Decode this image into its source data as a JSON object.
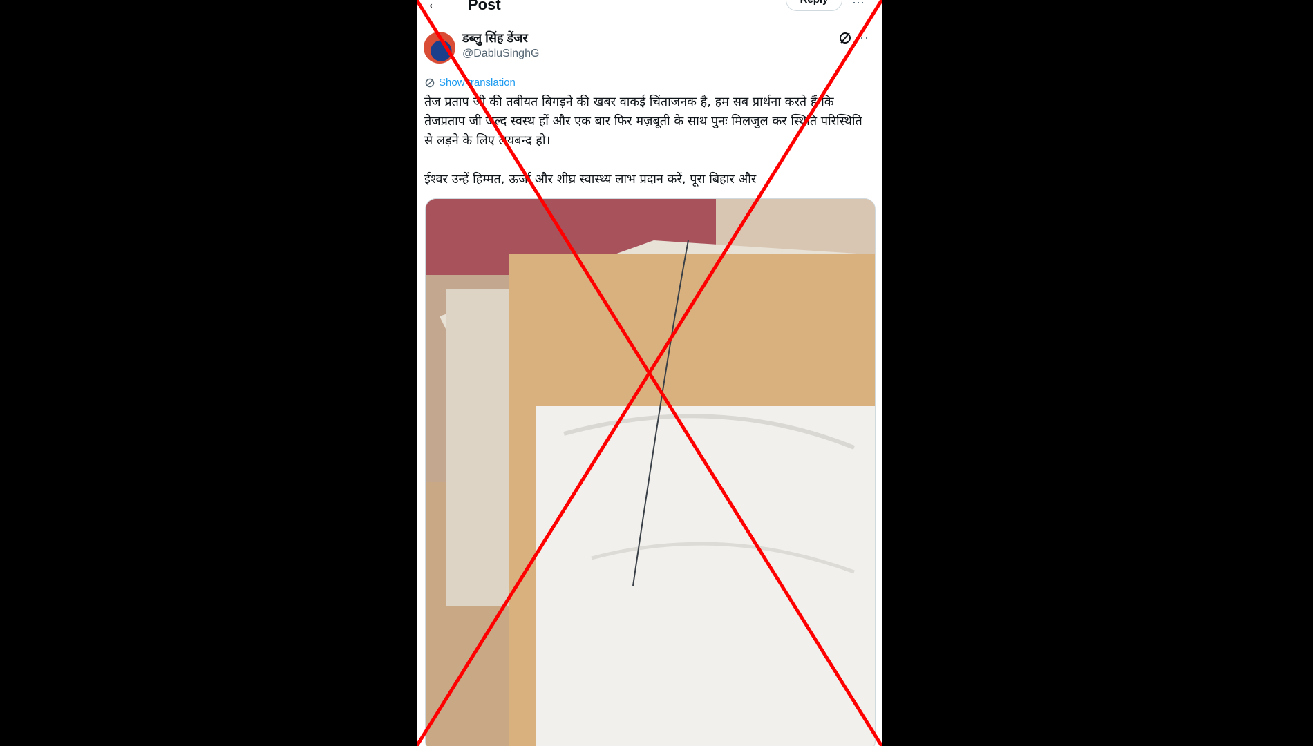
{
  "header": {
    "back_icon": "arrow-left-icon",
    "title": "Post",
    "reply_label": "Reply",
    "more_label": "⋯"
  },
  "post": {
    "display_name": "डब्लु सिंह डेंजर",
    "handle": "@DabluSinghG",
    "more_label": "···",
    "translate_label": "Show translation",
    "text_paragraph_1": "तेज प्रताप जी की तबीयत बिगड़ने की खबर वाकई चिंताजनक है, हम सब प्रार्थना करते हैं कि तेजप्रताप जी जल्द स्वस्थ हों और एक बार फिर मज़बूती के साथ पुनः मिलजुल कर स्थिति परिस्थिति से लड़ने के लिए लयबन्द हो।",
    "text_paragraph_2": "ईश्वर उन्हें हिम्मत, ऊर्जा और शीघ्र स्वास्थ्य लाभ प्रदान करें, पूरा बिहार और",
    "media_icon": "photo-placeholder"
  },
  "overlay": {
    "icon": "red-x-cross-mark",
    "color": "#ff0000"
  }
}
